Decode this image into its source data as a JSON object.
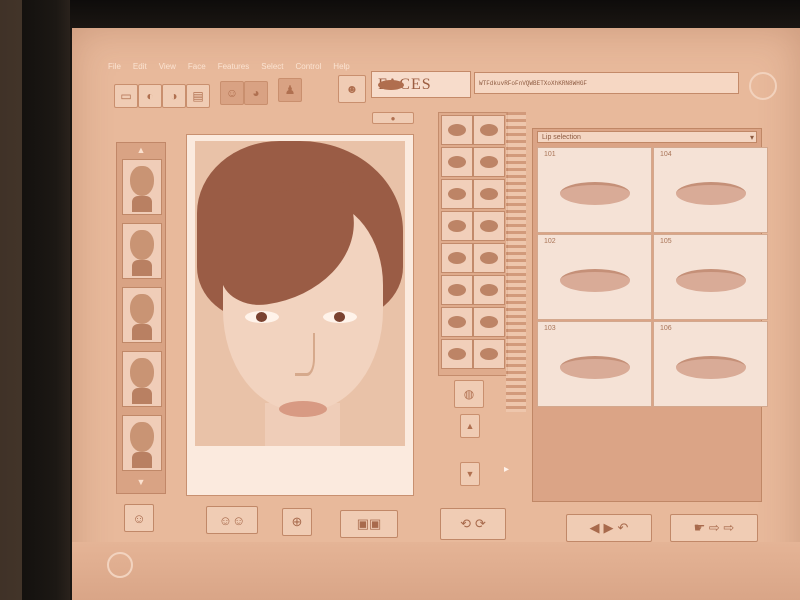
{
  "app": {
    "logo_text": "FACES",
    "code_field_value": "WTFdkuvRFoFnVQWBETXoXhKRN8WHGF"
  },
  "menu": [
    "File",
    "Edit",
    "View",
    "Face",
    "Features",
    "Select",
    "Control",
    "Help"
  ],
  "icons": {
    "toolbar": [
      "new-icon",
      "open-icon",
      "save-icon",
      "print-icon",
      "face-icon",
      "head-icon",
      "body-icon",
      "portrait-icon"
    ],
    "bottom": [
      "face-swap-icon",
      "compare-icon",
      "zoom-icon",
      "gallery-icon",
      "rotate-left-icon",
      "rotate-right-icon",
      "back-icon",
      "forward-icon",
      "undo-icon",
      "next-icon"
    ]
  },
  "lips_panel": {
    "selector_value": "Lip selection",
    "items": [
      {
        "number": "101"
      },
      {
        "number": "104"
      },
      {
        "number": "102"
      },
      {
        "number": "105"
      },
      {
        "number": "103"
      },
      {
        "number": "106"
      }
    ]
  },
  "colors": {
    "screen": "#e8b99b",
    "accent": "#9c5d40"
  }
}
